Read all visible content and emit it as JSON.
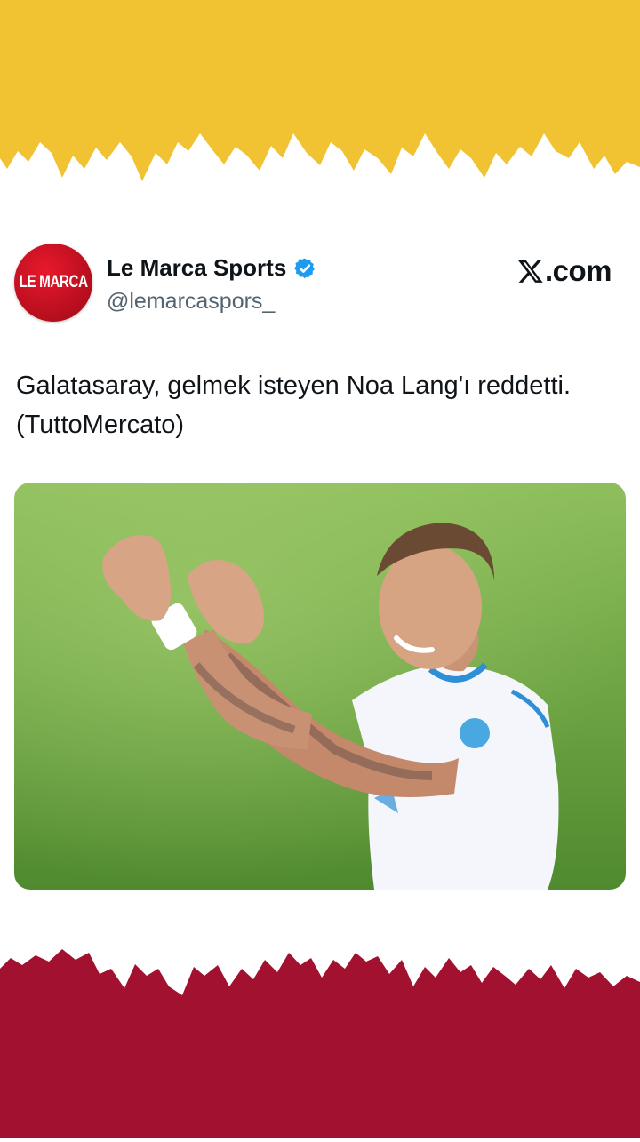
{
  "colors": {
    "top_band": "#f1c232",
    "bottom_band": "#a2112f",
    "verified_badge": "#1d9bf0",
    "text_primary": "#0f1419",
    "text_secondary": "#536471"
  },
  "tweet": {
    "avatar_text": "LE MARCA",
    "display_name": "Le Marca Sports",
    "handle": "@lemarcaspors_",
    "verified": true,
    "brand_label": ".com",
    "brand_icon": "x-logo-icon",
    "text": "Galatasaray, gelmek isteyen Noa Lang'ı reddetti. (TuttoMercato)",
    "media": {
      "type": "photo",
      "description_icon": "player-photo"
    }
  }
}
